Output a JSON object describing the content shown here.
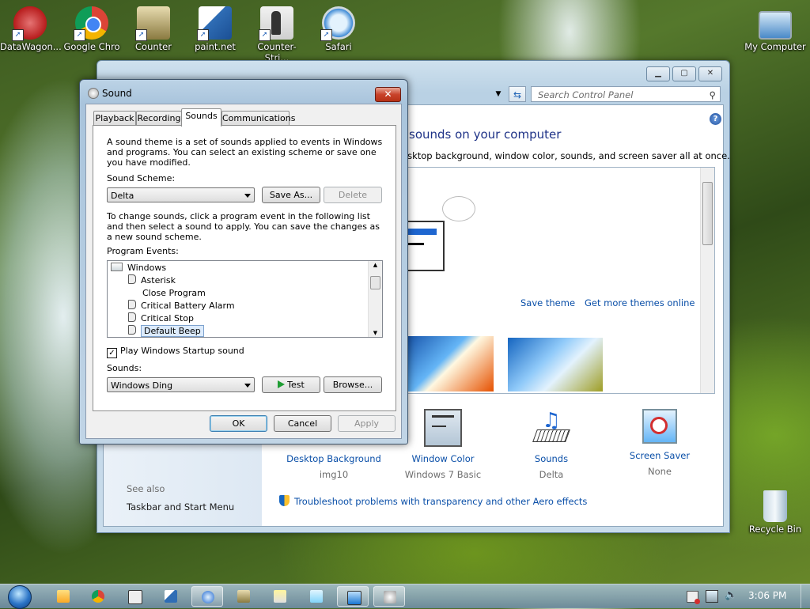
{
  "desktop": {
    "icons": [
      {
        "label": "DataWagon...",
        "color": "#c62828"
      },
      {
        "label": "Google Chro",
        "color": "#34a853"
      },
      {
        "label": "Counter",
        "color": "#8a7a40"
      },
      {
        "label": "paint.net",
        "color": "#2f6db5"
      },
      {
        "label": "Counter-Stri...",
        "color": "#555555"
      },
      {
        "label": "Safari",
        "color": "#3e8ad6"
      },
      {
        "label": "My Computer",
        "color": "#4a89c8"
      },
      {
        "label": "Recycle Bin",
        "color": "#9bb6c9"
      }
    ]
  },
  "control_panel": {
    "search_placeholder": "Search Control Panel",
    "heading": "sounds on your computer",
    "subtitle": "esktop background, window color, sounds, and screen saver all at once.",
    "save_theme": "Save theme",
    "get_more_themes": "Get more themes online",
    "bottom_items": [
      {
        "label": "Desktop Background",
        "value": "img10"
      },
      {
        "label": "Window Color",
        "value": "Windows 7 Basic"
      },
      {
        "label": "Sounds",
        "value": "Delta"
      },
      {
        "label": "Screen Saver",
        "value": "None"
      }
    ],
    "see_also": "See also",
    "taskbar_link": "Taskbar and Start Menu",
    "troubleshoot": "Troubleshoot problems with transparency and other Aero effects"
  },
  "sound_dialog": {
    "title": "Sound",
    "close_label": "✕",
    "tabs": [
      "Playback",
      "Recording",
      "Sounds",
      "Communications"
    ],
    "active_tab": "Sounds",
    "intro": "A sound theme is a set of sounds applied to events in Windows and programs.  You can select an existing scheme or save one you have modified.",
    "scheme_label": "Sound Scheme:",
    "scheme_value": "Delta",
    "save_as": "Save As...",
    "delete": "Delete",
    "instructions": "To change sounds, click a program event in the following list and then select a sound to apply.  You can save the changes as a new sound scheme.",
    "events_label": "Program Events:",
    "events": {
      "group": "Windows",
      "items": [
        "Asterisk",
        "Close Program",
        "Critical Battery Alarm",
        "Critical Stop",
        "Default Beep"
      ]
    },
    "startup_checkbox": "Play Windows Startup sound",
    "startup_checked": "✓",
    "sounds_label": "Sounds:",
    "sounds_value": "Windows Ding",
    "test": "Test",
    "browse": "Browse...",
    "ok": "OK",
    "cancel": "Cancel",
    "apply": "Apply"
  },
  "taskbar": {
    "time": "3:06 PM"
  }
}
